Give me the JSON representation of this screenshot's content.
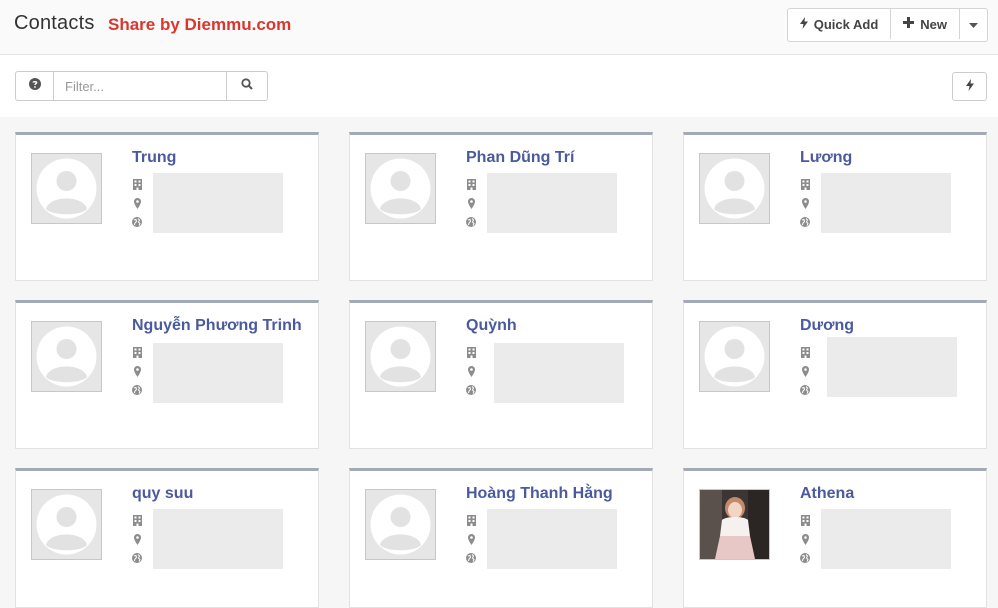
{
  "header": {
    "title": "Contacts",
    "watermark": "Share by Diemmu.com",
    "quick_add_label": "Quick Add",
    "new_label": "New"
  },
  "filter": {
    "placeholder": "Filter..."
  },
  "colors": {
    "name_link": "#4b5a9e",
    "card_top_border": "#a3aab6",
    "watermark": "#d9372e"
  },
  "contacts": [
    {
      "name": "Trung",
      "avatar": "placeholder"
    },
    {
      "name": "Phan Dũng Trí",
      "avatar": "placeholder"
    },
    {
      "name": "Lương",
      "avatar": "placeholder"
    },
    {
      "name": "Nguyễn Phương Trinh",
      "avatar": "placeholder"
    },
    {
      "name": "Quỳnh",
      "avatar": "placeholder"
    },
    {
      "name": "Dương",
      "avatar": "placeholder"
    },
    {
      "name": "quy suu",
      "avatar": "placeholder"
    },
    {
      "name": "Hoàng Thanh Hằng",
      "avatar": "placeholder"
    },
    {
      "name": "Athena",
      "avatar": "photo"
    }
  ],
  "icons": {
    "meta": [
      "building-icon",
      "map-marker-icon",
      "globe-icon"
    ]
  }
}
